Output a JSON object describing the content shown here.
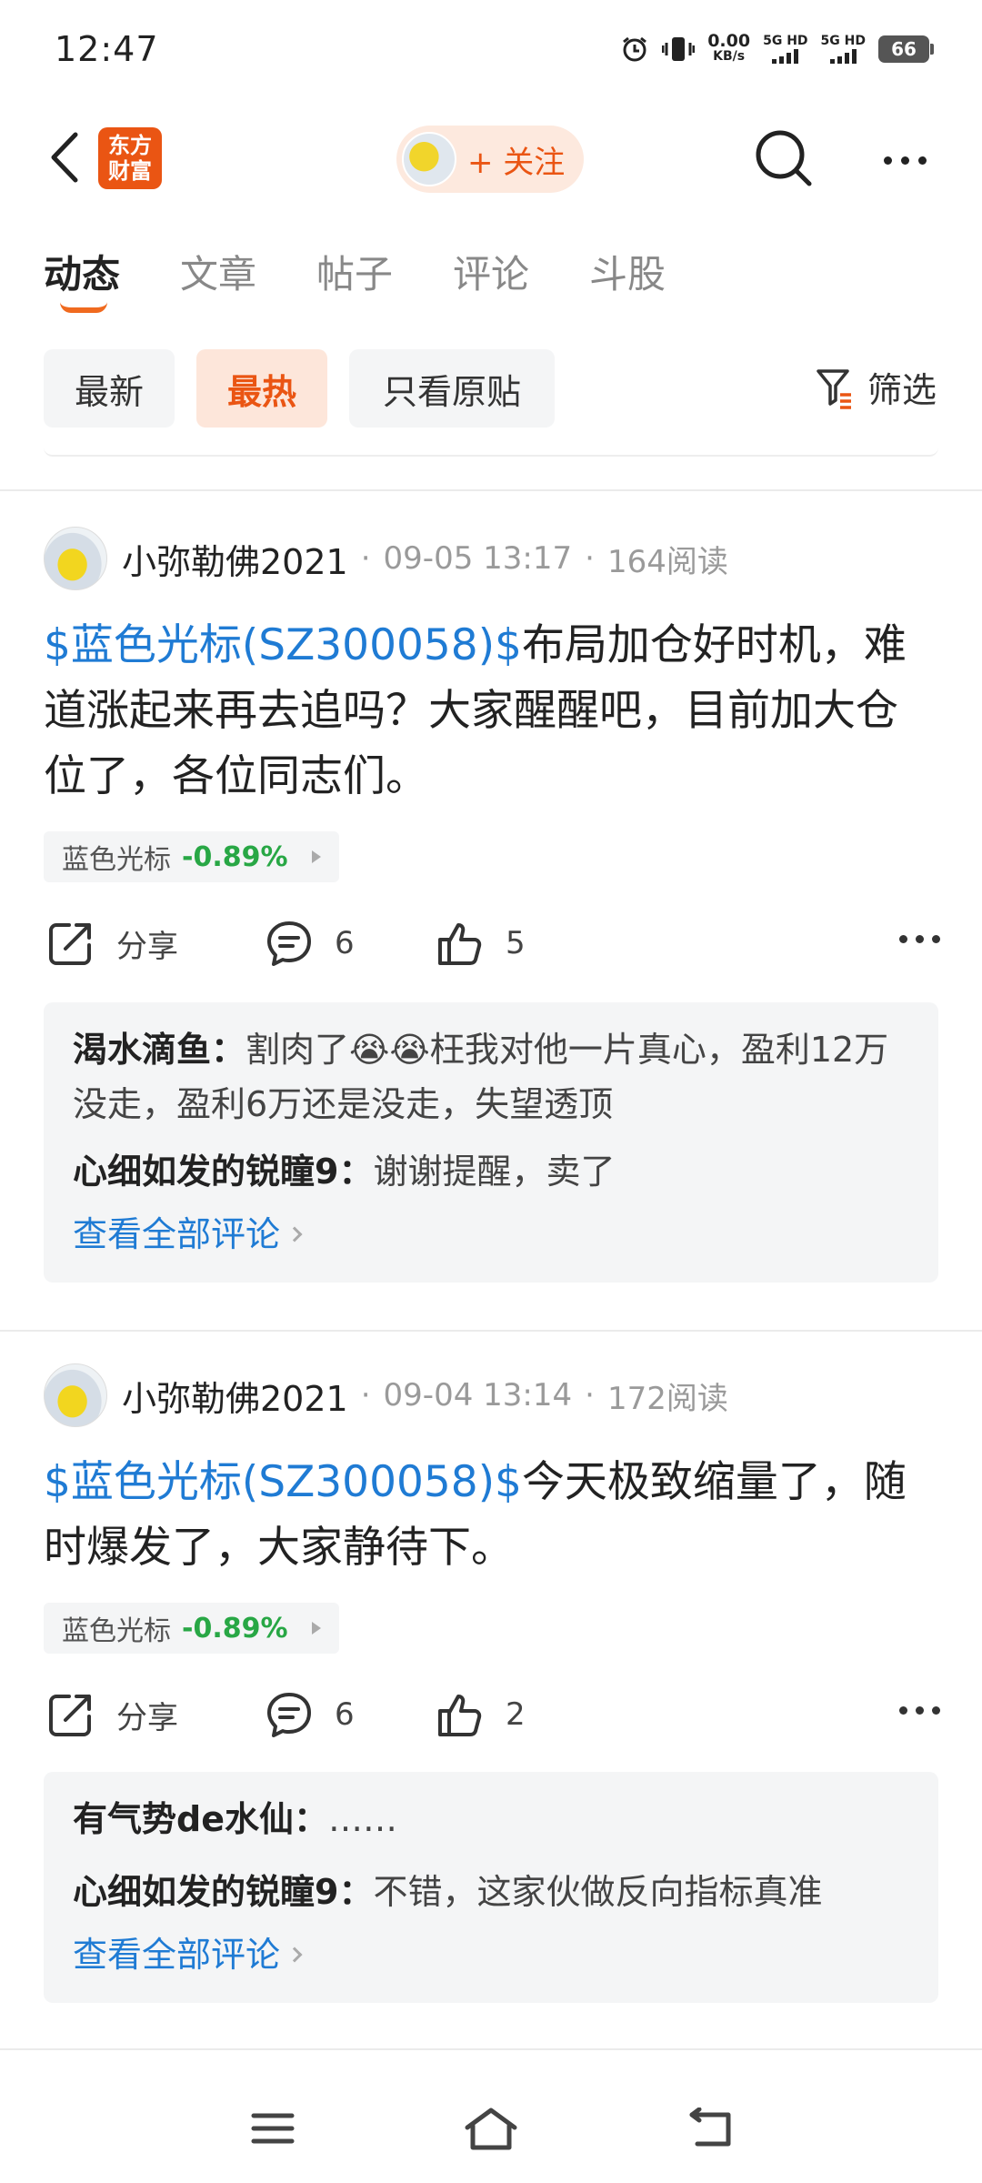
{
  "status_bar": {
    "time": "12:47",
    "net_speed_value": "0.00",
    "net_speed_unit": "KB/s",
    "sim1": "5G HD",
    "sim2": "5G HD",
    "battery": "66"
  },
  "header": {
    "logo_line1": "东方",
    "logo_line2": "财富",
    "follow_label": "+ 关注"
  },
  "tabs": [
    {
      "label": "动态",
      "active": true
    },
    {
      "label": "文章"
    },
    {
      "label": "帖子"
    },
    {
      "label": "评论"
    },
    {
      "label": "斗股"
    }
  ],
  "filters": {
    "latest": "最新",
    "hottest": "最热",
    "original_only": "只看原贴",
    "filter_label": "筛选"
  },
  "posts": [
    {
      "author": "小弥勒佛2021",
      "time": "09-05 13:17",
      "reads": "164阅读",
      "tag": "$蓝色光标(SZ300058)$",
      "text": "布局加仓好时机，难道涨起来再去追吗？大家醒醒吧，目前加大仓位了，各位同志们。",
      "stock_name": "蓝色光标",
      "stock_change": "-0.89%",
      "share_label": "分享",
      "comment_count": "6",
      "like_count": "5",
      "comments": [
        {
          "name": "渴水滴鱼：",
          "text": "割肉了😭😭枉我对他一片真心，盈利12万没走，盈利6万还是没走，失望透顶"
        },
        {
          "name": "心细如发的锐瞳9：",
          "text": "谢谢提醒，卖了"
        }
      ],
      "view_all": "查看全部评论"
    },
    {
      "author": "小弥勒佛2021",
      "time": "09-04 13:14",
      "reads": "172阅读",
      "tag": "$蓝色光标(SZ300058)$",
      "text": "今天极致缩量了，随时爆发了，大家静待下。",
      "stock_name": "蓝色光标",
      "stock_change": "-0.89%",
      "share_label": "分享",
      "comment_count": "6",
      "like_count": "2",
      "comments": [
        {
          "name": "有气势de水仙：",
          "text": "……"
        },
        {
          "name": "心细如发的锐瞳9：",
          "text": "不错，这家伙做反向指标真准"
        }
      ],
      "view_all": "查看全部评论"
    }
  ],
  "colors": {
    "accent": "#ea5513",
    "link": "#1f7bd4",
    "down_green": "#28a745"
  }
}
